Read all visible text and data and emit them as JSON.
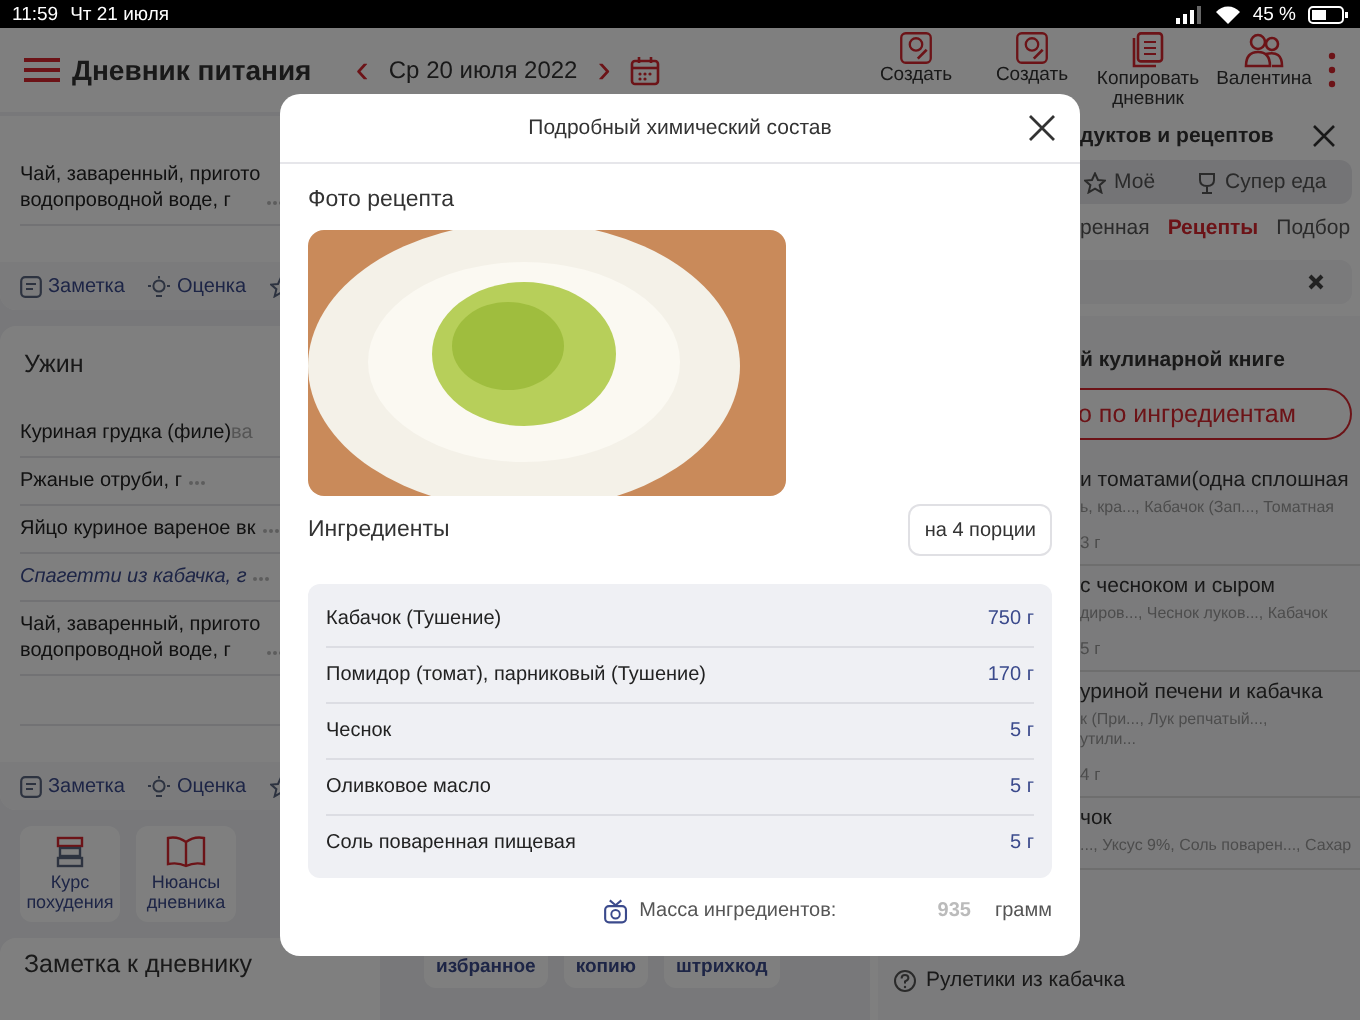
{
  "status_bar": {
    "time": "11:59",
    "date": "Чт 21 июля",
    "battery": "45 %"
  },
  "header": {
    "title": "Дневник питания",
    "prev": "‹",
    "date": "Ср 20 июля 2022",
    "next": "›",
    "actions": [
      {
        "label": "Создать"
      },
      {
        "label": "Создать"
      },
      {
        "label": "Копировать дневник"
      },
      {
        "label": "Валентина"
      }
    ]
  },
  "meals": [
    {
      "items": [
        {
          "lines": [
            "Чай, заваренный, пригото",
            "водопроводной воде, г"
          ],
          "highlighted": false
        }
      ],
      "actions": [
        "Заметка",
        "Оценка"
      ]
    },
    {
      "title": "Ужин",
      "items": [
        {
          "lines": [
            "Куриная грудка (филе)"
          ],
          "note": "ва",
          "highlighted": false
        },
        {
          "lines": [
            "Ржаные отруби, г"
          ],
          "highlighted": false
        },
        {
          "lines": [
            "Яйцо куриное вареное вк"
          ],
          "highlighted": false
        },
        {
          "lines": [
            "Спагетти из кабачка, г"
          ],
          "highlighted": true
        },
        {
          "lines": [
            "Чай, заваренный, пригото",
            "водопроводной воде, г"
          ],
          "highlighted": false
        }
      ],
      "actions": [
        "Заметка",
        "Оценка"
      ]
    }
  ],
  "tiles": [
    {
      "label": "Курс похудения"
    },
    {
      "label": "Нюансы дневника"
    }
  ],
  "diary_note": "Заметка к дневнику",
  "middle_buttons": [
    "избранное",
    "копию",
    "штрихкод"
  ],
  "panel": {
    "title": "дуктов и рецептов",
    "tabs": [
      {
        "label": "Моё"
      },
      {
        "label": "Супер еда"
      }
    ],
    "subtabs": [
      {
        "label": "ренная",
        "selected": false
      },
      {
        "label": "Рецепты",
        "selected": true
      },
      {
        "label": "Подбор",
        "selected": false
      }
    ],
    "section_title": "й кулинарной книге",
    "ingredient_button": "о по ингредиентам",
    "recipes": [
      {
        "lines": [
          "и томатами(одна сплошная"
        ],
        "ingredients": [
          "ь, кра..., Кабачок (Зап..., Томатная"
        ],
        "weight": "3 г"
      },
      {
        "lines": [
          "с чесноком и сыром"
        ],
        "ingredients": [
          "диров..., Чеснок луков..., Кабачок"
        ],
        "weight": "5 г"
      },
      {
        "lines": [
          "уриной печени и кабачка"
        ],
        "ingredients": [
          "к (При..., Лук репчатый...,",
          "утили..."
        ],
        "weight": "4 г"
      },
      {
        "lines": [
          "чок"
        ],
        "ingredients": [
          "..., Уксус 9%, Соль поварен..., Сахар"
        ]
      }
    ],
    "footer_recipe": "Рулетики из кабачка"
  },
  "modal": {
    "title": "Подробный химический состав",
    "photo_label": "Фото рецепта",
    "ingredients_label": "Ингредиенты",
    "portions": "на 4 порции",
    "ingredients": [
      {
        "name": "Кабачок (Тушение)",
        "amount": "750 г"
      },
      {
        "name": "Помидор (томат), парниковый (Тушение)",
        "amount": "170 г"
      },
      {
        "name": "Чеснок",
        "amount": "5 г"
      },
      {
        "name": "Оливковое масло",
        "amount": "5 г"
      },
      {
        "name": "Соль поваренная пищевая",
        "amount": "5 г"
      }
    ],
    "mass_label": "Масса ингредиентов:",
    "mass_value": "935",
    "mass_unit": "грамм"
  }
}
